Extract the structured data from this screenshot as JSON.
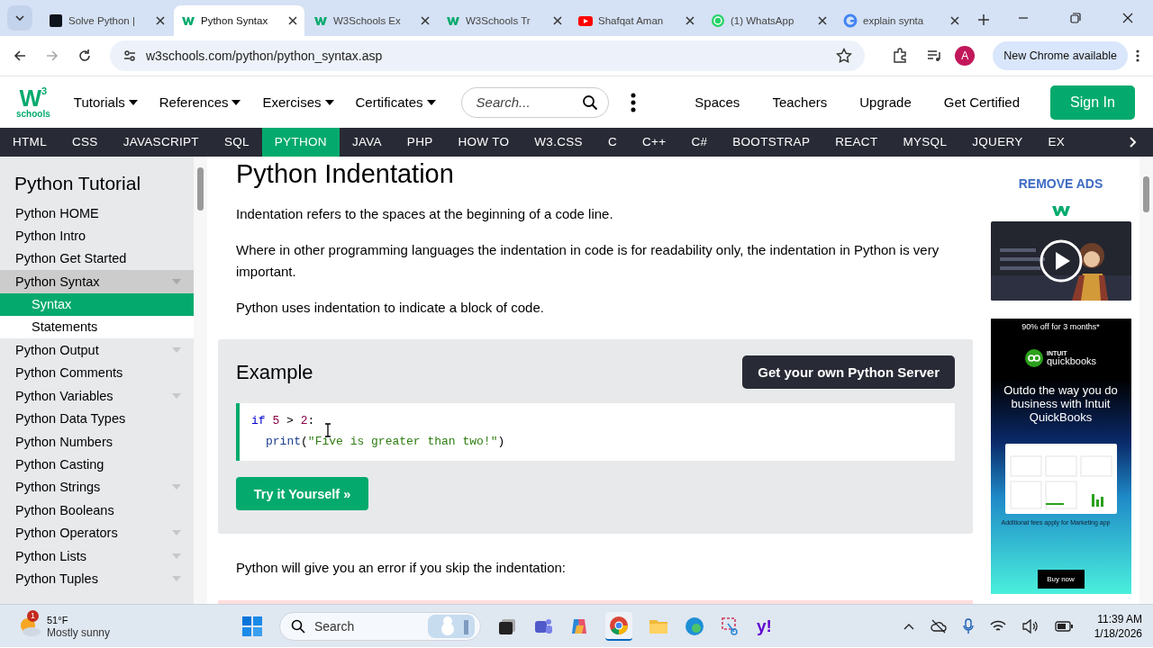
{
  "browser": {
    "tabs": [
      {
        "title": "Solve Python |",
        "kind": "hackerrank",
        "selected": false
      },
      {
        "title": "Python Syntax",
        "kind": "w3",
        "selected": true
      },
      {
        "title": "W3Schools Ex",
        "kind": "w3",
        "selected": false
      },
      {
        "title": "W3Schools Tr",
        "kind": "w3",
        "selected": false
      },
      {
        "title": "Shafqat Aman",
        "kind": "youtube",
        "selected": false
      },
      {
        "title": "(1) WhatsApp",
        "kind": "whatsapp",
        "selected": false
      },
      {
        "title": "explain synta",
        "kind": "google",
        "selected": false
      }
    ],
    "url": "w3schools.com/python/python_syntax.asp",
    "profile": "A",
    "update": "New Chrome available"
  },
  "site": {
    "logo": {
      "letter": "W",
      "sup": "3",
      "word": "schools"
    },
    "menus": [
      "Tutorials",
      "References",
      "Exercises",
      "Certificates"
    ],
    "search": {
      "placeholder": "Search..."
    },
    "links": [
      "Spaces",
      "Teachers",
      "Upgrade",
      "Get Certified"
    ],
    "sign_in": "Sign In",
    "subjects": [
      {
        "label": "HTML",
        "selected": false
      },
      {
        "label": "CSS",
        "selected": false
      },
      {
        "label": "JAVASCRIPT",
        "selected": false
      },
      {
        "label": "SQL",
        "selected": false
      },
      {
        "label": "PYTHON",
        "selected": true
      },
      {
        "label": "JAVA",
        "selected": false
      },
      {
        "label": "PHP",
        "selected": false
      },
      {
        "label": "HOW TO",
        "selected": false
      },
      {
        "label": "W3.CSS",
        "selected": false
      },
      {
        "label": "C",
        "selected": false
      },
      {
        "label": "C++",
        "selected": false
      },
      {
        "label": "C#",
        "selected": false
      },
      {
        "label": "BOOTSTRAP",
        "selected": false
      },
      {
        "label": "REACT",
        "selected": false
      },
      {
        "label": "MYSQL",
        "selected": false
      },
      {
        "label": "JQUERY",
        "selected": false
      },
      {
        "label": "EX",
        "selected": false
      }
    ]
  },
  "sidebar": {
    "title": "Python Tutorial",
    "items": [
      {
        "label": "Python HOME",
        "submenu": false,
        "selected": false
      },
      {
        "label": "Python Intro",
        "submenu": false,
        "selected": false
      },
      {
        "label": "Python Get Started",
        "submenu": false,
        "selected": false
      },
      {
        "label": "Python Syntax",
        "submenu": true,
        "selected": true,
        "children": [
          {
            "label": "Syntax",
            "selected": true
          },
          {
            "label": "Statements",
            "selected": false
          }
        ]
      },
      {
        "label": "Python Output",
        "submenu": true,
        "selected": false
      },
      {
        "label": "Python Comments",
        "submenu": false,
        "selected": false
      },
      {
        "label": "Python Variables",
        "submenu": true,
        "selected": false
      },
      {
        "label": "Python Data Types",
        "submenu": false,
        "selected": false
      },
      {
        "label": "Python Numbers",
        "submenu": false,
        "selected": false
      },
      {
        "label": "Python Casting",
        "submenu": false,
        "selected": false
      },
      {
        "label": "Python Strings",
        "submenu": true,
        "selected": false
      },
      {
        "label": "Python Booleans",
        "submenu": false,
        "selected": false
      },
      {
        "label": "Python Operators",
        "submenu": true,
        "selected": false
      },
      {
        "label": "Python Lists",
        "submenu": true,
        "selected": false
      },
      {
        "label": "Python Tuples",
        "submenu": true,
        "selected": false
      }
    ]
  },
  "content": {
    "heading": "Python Indentation",
    "paragraphs": [
      "Indentation refers to the spaces at the beginning of a code line.",
      "Where in other programming languages the indentation in code is for readability only, the indentation in Python is very important.",
      "Python uses indentation to indicate a block of code."
    ],
    "example": {
      "title": "Example",
      "server_button": "Get your own Python Server",
      "code": [
        {
          "indented": false,
          "tokens": [
            {
              "text": "if ",
              "kind": "keyword"
            },
            {
              "text": "5",
              "kind": "number"
            },
            {
              "text": " > ",
              "kind": "plain"
            },
            {
              "text": "2",
              "kind": "number"
            },
            {
              "text": ":",
              "kind": "plain"
            }
          ]
        },
        {
          "indented": true,
          "tokens": [
            {
              "text": "print",
              "kind": "function"
            },
            {
              "text": "(",
              "kind": "plain"
            },
            {
              "text": "\"Five is greater than two!\"",
              "kind": "string"
            },
            {
              "text": ")",
              "kind": "plain"
            }
          ]
        }
      ],
      "try_button": "Try it Yourself »"
    },
    "after": "Python will give you an error if you skip the indentation:"
  },
  "ads": {
    "remove": "REMOVE ADS",
    "banner": {
      "offer": "90% off for 3 months*",
      "brand_top": "INTUIT",
      "brand": "quickbooks",
      "headline": "Outdo the way you do business with Intuit QuickBooks",
      "fine_print": "Additional fees apply for Marketing app",
      "button": "Buy now"
    }
  },
  "taskbar": {
    "weather": {
      "badge": "1",
      "temp": "51°F",
      "condition": "Mostly sunny"
    },
    "search": "Search",
    "yahoo": "y!",
    "time": "11:39 AM",
    "date": "1/18/2026"
  }
}
